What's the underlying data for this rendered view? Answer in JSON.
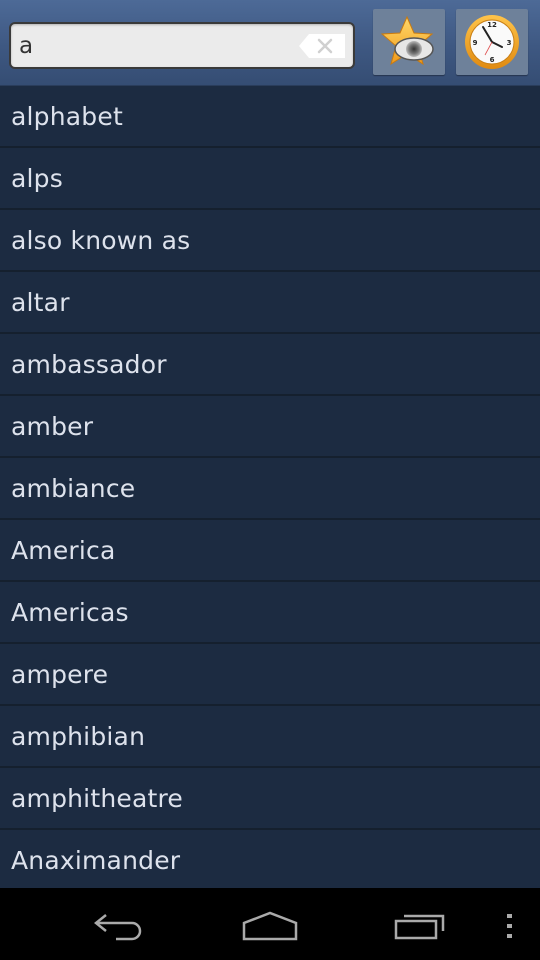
{
  "search": {
    "value": "a",
    "placeholder": ""
  },
  "toolbar": {
    "clear_icon": "backspace-clear-icon",
    "favorites_icon": "star-eye-icon",
    "history_icon": "clock-icon"
  },
  "list": {
    "items": [
      {
        "label": "alphabet"
      },
      {
        "label": "alps"
      },
      {
        "label": "also known as"
      },
      {
        "label": "altar"
      },
      {
        "label": "ambassador"
      },
      {
        "label": "amber"
      },
      {
        "label": "ambiance"
      },
      {
        "label": "America"
      },
      {
        "label": "Americas"
      },
      {
        "label": "ampere"
      },
      {
        "label": "amphibian"
      },
      {
        "label": "amphitheatre"
      },
      {
        "label": "Anaximander"
      }
    ]
  },
  "navbar": {
    "back_icon": "back-icon",
    "home_icon": "home-icon",
    "recents_icon": "recent-apps-icon",
    "menu_icon": "overflow-menu-icon"
  },
  "colors": {
    "header_top": "#4d6a97",
    "header_bottom": "#354d73",
    "list_bg": "#1c2b41",
    "divider": "#15202e",
    "item_text": "#dde2ec",
    "button_bg": "#6e819a",
    "star": "#f5b530",
    "clock_rim": "#f0a020"
  }
}
